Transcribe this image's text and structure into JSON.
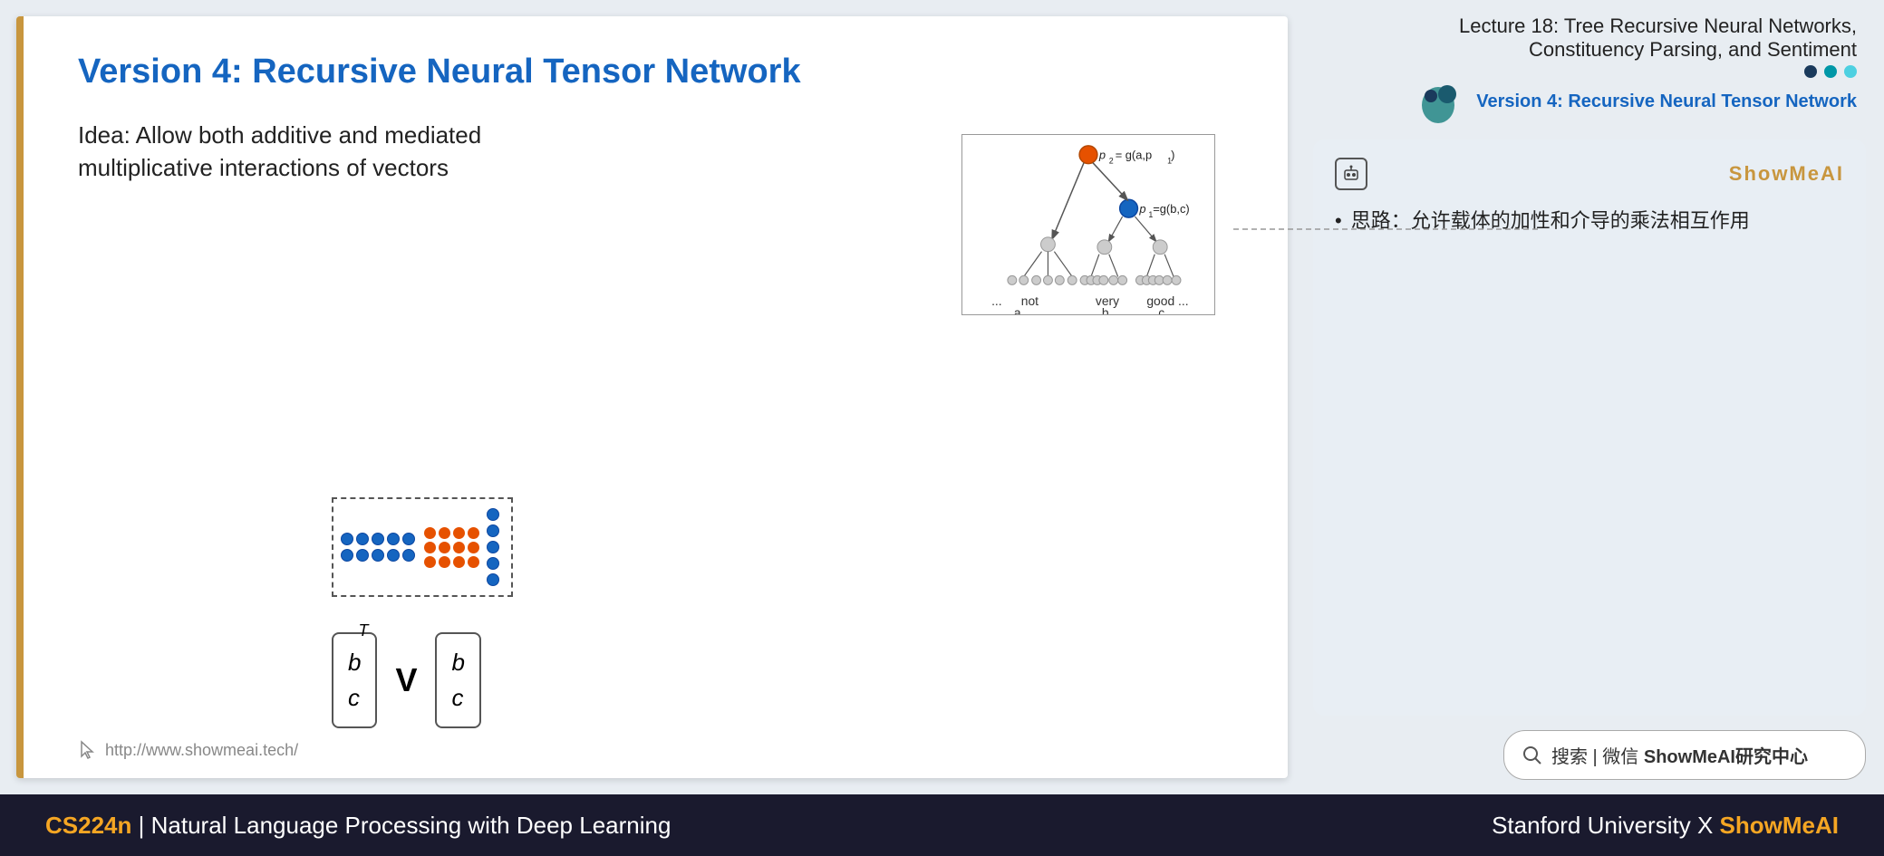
{
  "header": {
    "lecture_line1": "Lecture 18: Tree Recursive Neural Networks,",
    "lecture_line2": "Constituency Parsing, and Sentiment",
    "subtitle": "Version 4: Recursive Neural Tensor Network"
  },
  "slide": {
    "title": "Version 4: Recursive Neural Tensor Network",
    "body_text": "Idea: Allow both additive and mediated multiplicative interactions of vectors",
    "url": "http://www.showmeai.tech/"
  },
  "ai_box": {
    "brand": "ShowMeAI",
    "bullet": "思路：允许载体的加性和介导的乘法相互作用"
  },
  "search": {
    "label": "搜索 | 微信 ShowMeAI研究中心"
  },
  "footer": {
    "course_code": "CS224n",
    "separator": " | ",
    "course_name": "Natural Language Processing with Deep Learning",
    "university": "Stanford University",
    "x": " X ",
    "brand": "ShowMeAI"
  }
}
